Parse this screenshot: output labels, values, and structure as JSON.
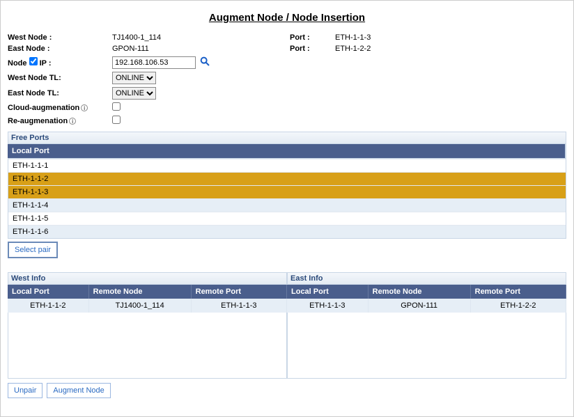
{
  "title": "Augment Node / Node Insertion",
  "labels": {
    "westNode": "West Node :",
    "eastNode": "East Node :",
    "nodeIp": "Node",
    "ipSuffix": "IP :",
    "port": "Port :",
    "westTL": "West Node TL:",
    "eastTL": "East Node TL:",
    "cloudAug": "Cloud-augmenation",
    "reAug": "Re-augmenation"
  },
  "values": {
    "westNode": "TJ1400-1_114",
    "eastNode": "GPON-111",
    "westPort": "ETH-1-1-3",
    "eastPort": "ETH-1-2-2",
    "ip": "192.168.106.53",
    "westTL": "ONLINE",
    "eastTL": "ONLINE"
  },
  "freePorts": {
    "title": "Free Ports",
    "headerLocal": "Local Port",
    "rows": [
      "ETH-1-1-1",
      "ETH-1-1-2",
      "ETH-1-1-3",
      "ETH-1-1-4",
      "ETH-1-1-5",
      "ETH-1-1-6"
    ]
  },
  "buttons": {
    "selectPair": "Select pair",
    "unpair": "Unpair",
    "augment": "Augment Node"
  },
  "westInfo": {
    "title": "West Info",
    "cols": {
      "local": "Local Port",
      "remoteNode": "Remote Node",
      "remotePort": "Remote Port"
    },
    "row": {
      "local": "ETH-1-1-2",
      "remoteNode": "TJ1400-1_114",
      "remotePort": "ETH-1-1-3"
    }
  },
  "eastInfo": {
    "title": "East Info",
    "cols": {
      "local": "Local Port",
      "remoteNode": "Remote Node",
      "remotePort": "Remote Port"
    },
    "row": {
      "local": "ETH-1-1-3",
      "remoteNode": "GPON-111",
      "remotePort": "ETH-1-2-2"
    }
  }
}
